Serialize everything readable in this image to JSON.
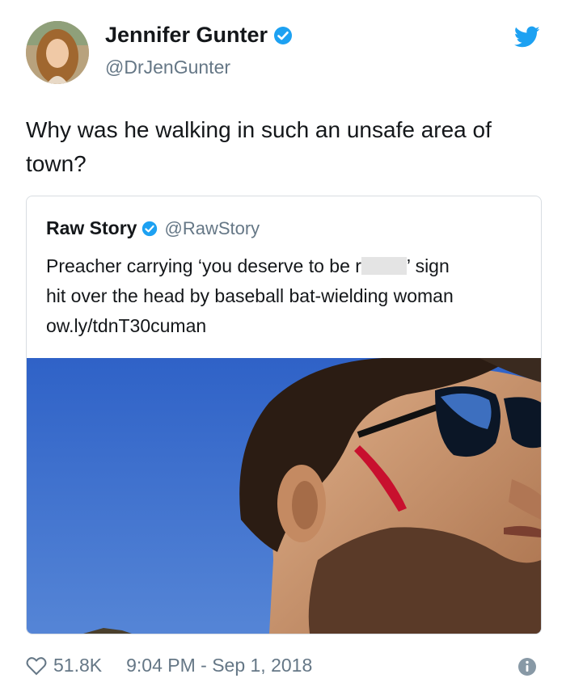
{
  "author": {
    "display_name": "Jennifer Gunter",
    "handle": "@DrJenGunter",
    "verified": true
  },
  "tweet": {
    "text": "Why was he walking in such an unsafe area of town?"
  },
  "quoted_tweet": {
    "display_name": "Raw Story",
    "handle": "@RawStory",
    "verified": true,
    "text_before_redaction": "Preacher carrying ‘you deserve to be r",
    "text_after_redaction": "’ sign",
    "text_line2": "hit over the head by baseball bat-wielding woman",
    "link": "ow.ly/tdnT30cuman"
  },
  "footer": {
    "likes": "51.8K",
    "timestamp": "9:04 PM - Sep 1, 2018"
  },
  "icons": {
    "verified": "verified-badge-icon",
    "brand": "twitter-bird-icon",
    "like": "heart-icon",
    "info": "info-icon"
  },
  "colors": {
    "twitter_blue": "#1da1f2",
    "secondary_text": "#657786",
    "border": "#d8dde2"
  }
}
